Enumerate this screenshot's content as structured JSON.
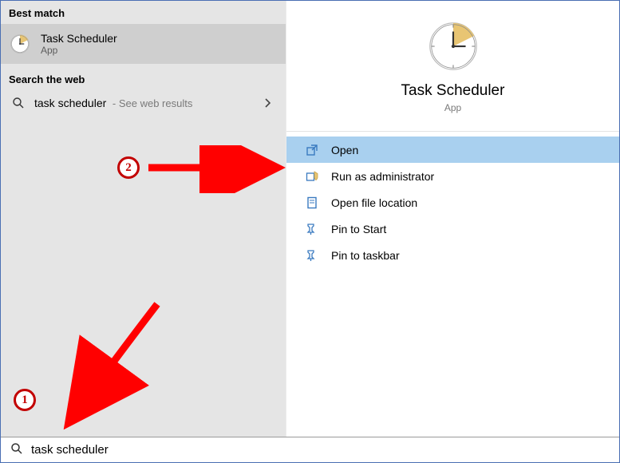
{
  "left": {
    "best_match_header": "Best match",
    "best_match": {
      "title": "Task Scheduler",
      "subtitle": "App"
    },
    "web_header": "Search the web",
    "web_item": {
      "query": "task scheduler",
      "hint": "- See web results"
    }
  },
  "right": {
    "title": "Task Scheduler",
    "subtitle": "App",
    "actions": {
      "open": "Open",
      "run_admin": "Run as administrator",
      "open_location": "Open file location",
      "pin_start": "Pin to Start",
      "pin_taskbar": "Pin to taskbar"
    }
  },
  "search": {
    "value": "task scheduler"
  },
  "annotations": {
    "label1": "1",
    "label2": "2"
  }
}
